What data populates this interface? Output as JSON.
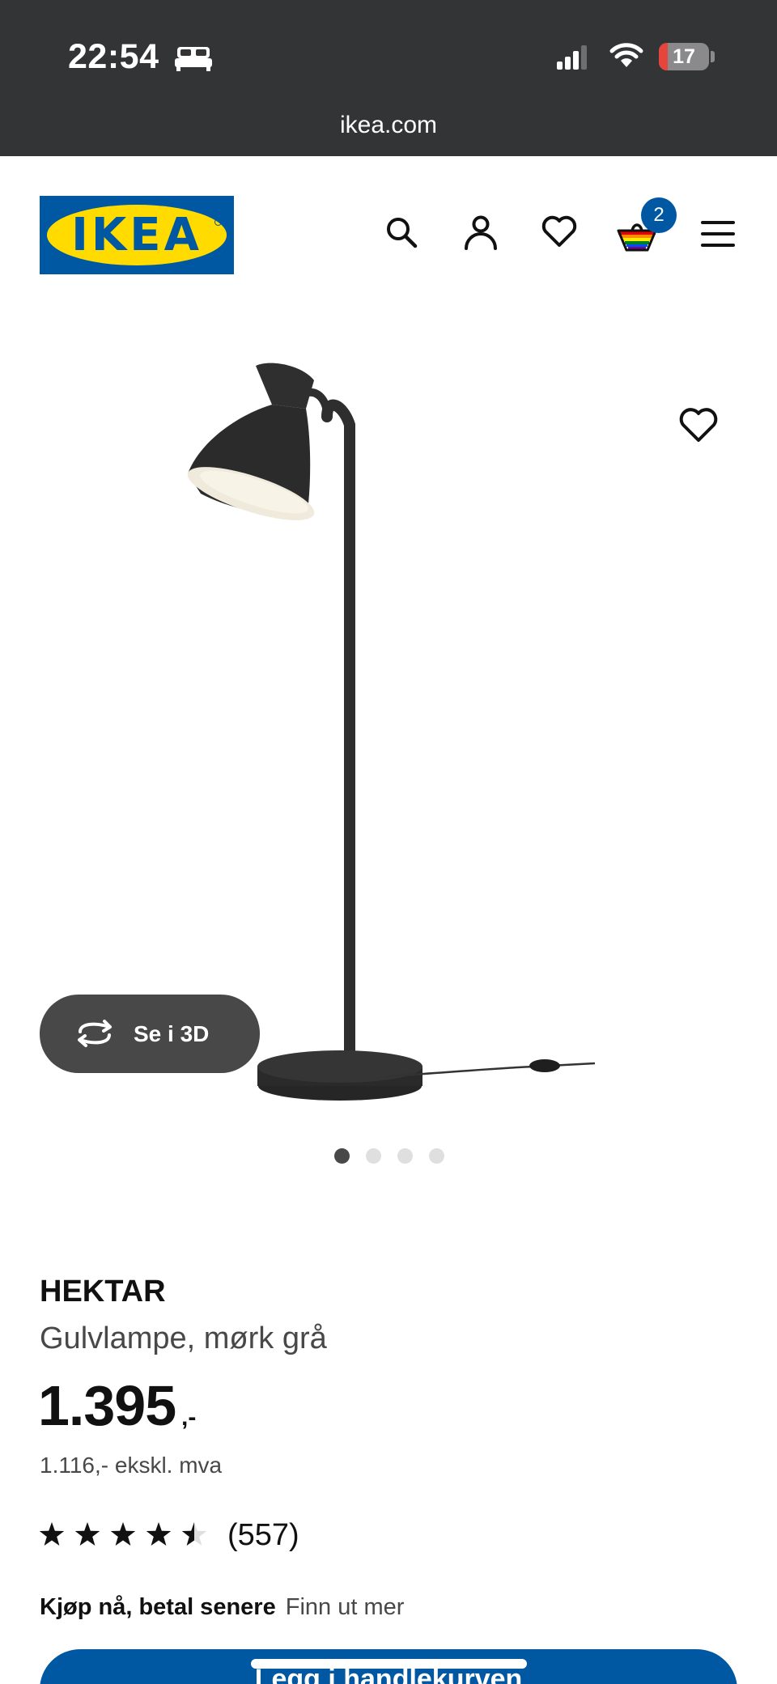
{
  "status_bar": {
    "time": "22:54",
    "battery_level": "17",
    "battery_fraction": 0.17,
    "url": "ikea.com"
  },
  "header": {
    "logo_text": "IKEA",
    "cart_count": "2",
    "icons": [
      "search-icon",
      "user-icon",
      "heart-icon",
      "cart-icon",
      "menu-icon"
    ]
  },
  "product": {
    "name": "HEKTAR",
    "description": "Gulvlampe, mørk grå",
    "price": "1.395",
    "price_suffix": ",-",
    "price_ex_vat": "1.116,- ekskl. mva",
    "rating": 4.5,
    "review_count": "(557)",
    "view_3d_label": "Se i 3D",
    "gallery_count": 4,
    "gallery_active_index": 0
  },
  "payment": {
    "bnpl_label": "Kjøp nå, betal senere",
    "bnpl_link": "Finn ut mer"
  },
  "cta": {
    "label": "Legg i handlekurven"
  },
  "colors": {
    "status_bar": "#333436",
    "brand_blue": "#0058a3",
    "brand_yellow": "#ffdb00",
    "text": "#111111",
    "muted_text": "#484848",
    "battery_low": "#e5453d"
  }
}
